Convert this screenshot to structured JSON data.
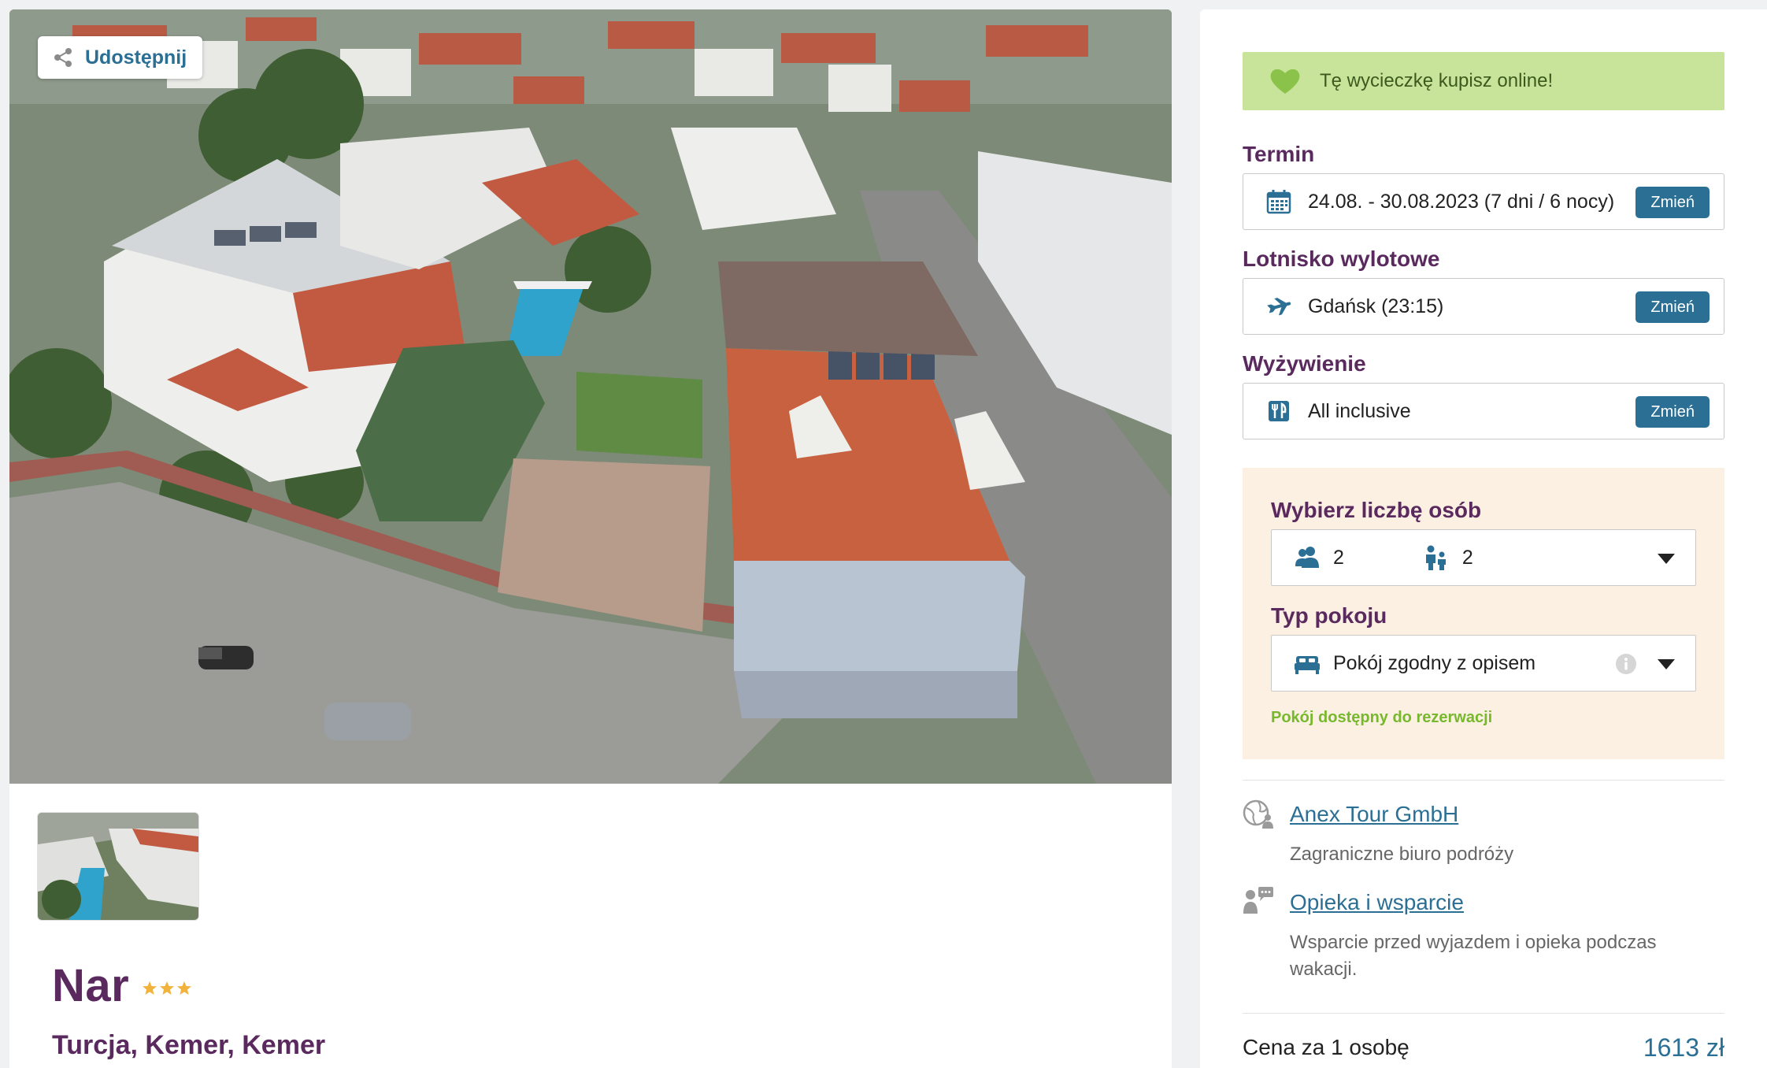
{
  "gallery": {
    "share_label": "Udostępnij",
    "hero_alt": "Widok z lotu ptaka na hotel",
    "thumbnail_alt": "Hotel z basenem"
  },
  "hotel": {
    "name": "Nar",
    "stars": 3,
    "location": "Turcja, Kemer, Kemer",
    "star_color": "#f2b33d"
  },
  "booking": {
    "online_banner": "Tę wycieczkę kupisz online!",
    "term": {
      "label": "Termin",
      "value": "24.08. - 30.08.2023 (7 dni / 6 nocy)",
      "change_label": "Zmień"
    },
    "airport": {
      "label": "Lotnisko wylotowe",
      "value": "Gdańsk (23:15)",
      "change_label": "Zmień"
    },
    "board": {
      "label": "Wyżywienie",
      "value": "All inclusive",
      "change_label": "Zmień"
    },
    "persons": {
      "label": "Wybierz liczbę osób",
      "adults": "2",
      "children": "2"
    },
    "room": {
      "label": "Typ pokoju",
      "value": "Pokój zgodny z opisem",
      "availability": "Pokój dostępny do rezerwacji"
    }
  },
  "organizer": {
    "name": "Anex Tour GmbH",
    "description": "Zagraniczne biuro podróży"
  },
  "support": {
    "title": "Opieka i wsparcie",
    "description": "Wsparcie przed wyjazdem i opieka podczas wakacji."
  },
  "price": {
    "label": "Cena za 1 osobę",
    "value": "1613 zł"
  },
  "colors": {
    "brand_purple": "#5a2a5e",
    "link_blue": "#2b6f95",
    "banner_green": "#c8e49a",
    "heart_green": "#8bc34a",
    "availability_green": "#77b82c",
    "config_bg": "#fbf0e2"
  }
}
